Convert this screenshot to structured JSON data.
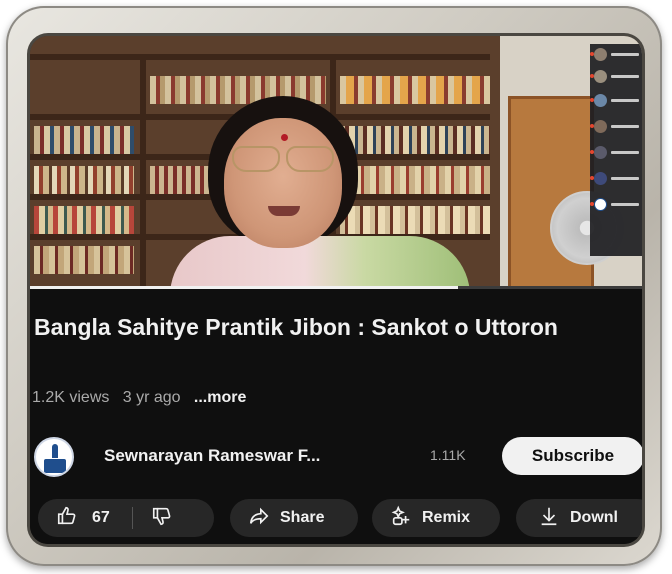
{
  "video": {
    "progress": 0.7,
    "participant_count": 6
  },
  "title": "Bangla Sahitye Prantik Jibon : Sankot o Uttoron",
  "meta": {
    "views": "1.2K views",
    "age": "3 yr ago",
    "more": "...more"
  },
  "channel": {
    "name": "Sewnarayan Rameswar F...",
    "subscribers": "1.11K",
    "subscribe_label": "Subscribe"
  },
  "actions": {
    "likes": "67",
    "share": "Share",
    "remix": "Remix",
    "download": "Downl"
  },
  "icons": [
    "thumbs-up-icon",
    "thumbs-down-icon",
    "share-icon",
    "remix-icon",
    "download-icon"
  ],
  "colors": {
    "background": "#0f0f0f",
    "pill": "#272727",
    "text": "#f1f1f1",
    "muted": "#aaaaaa",
    "subscribe_bg": "#f1f1f1"
  }
}
